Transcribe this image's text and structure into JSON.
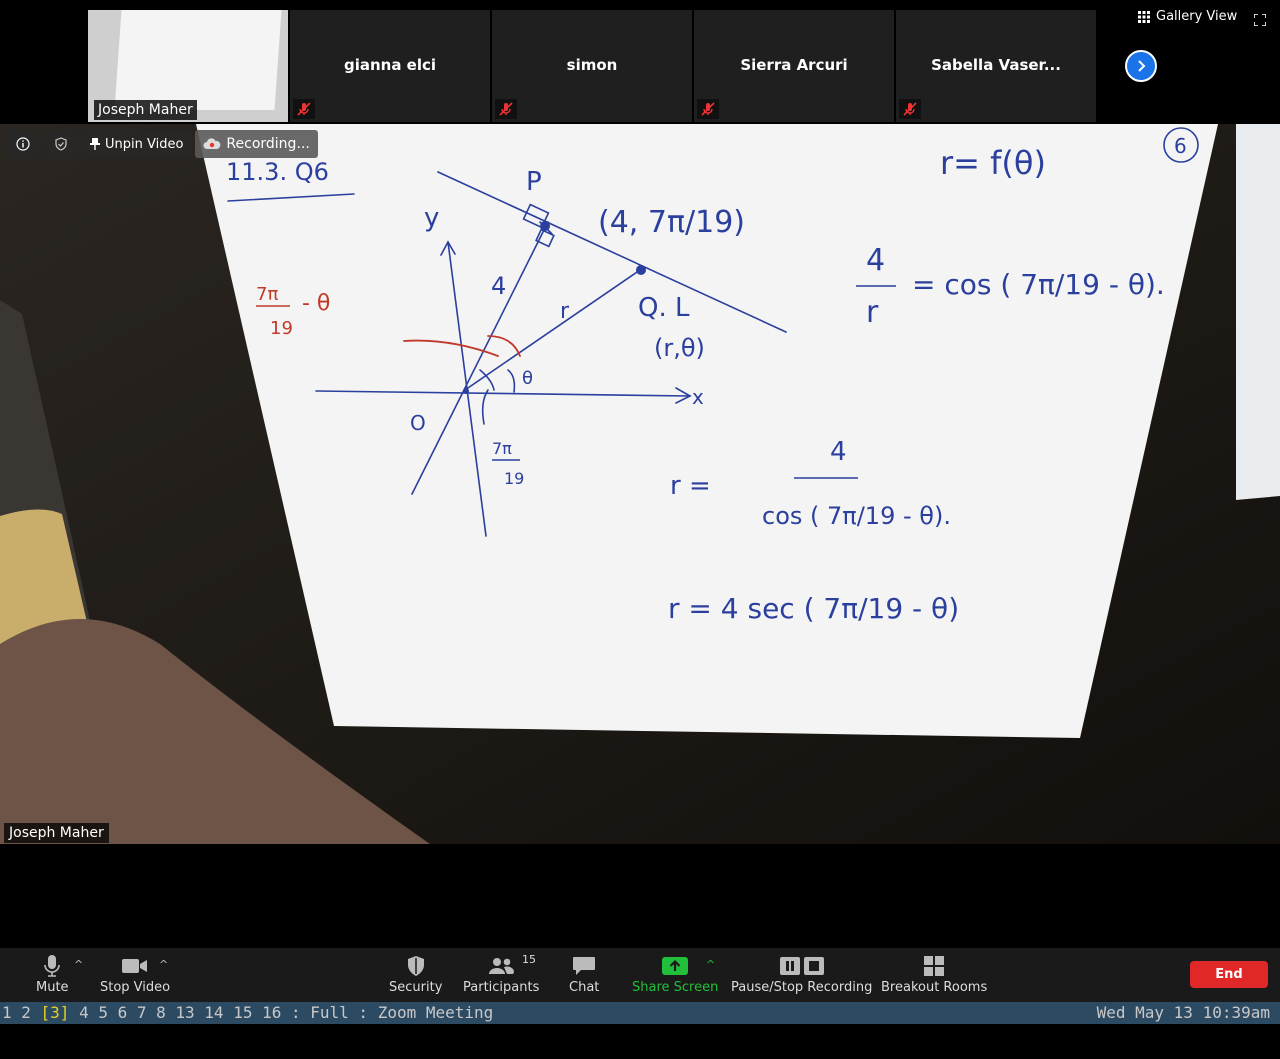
{
  "gallery": {
    "view_label": "Gallery View",
    "tiles": [
      {
        "name": "Joseph Maher",
        "muted": false
      },
      {
        "name": "gianna elci",
        "muted": true
      },
      {
        "name": "simon",
        "muted": true
      },
      {
        "name": "Sierra Arcuri",
        "muted": true
      },
      {
        "name": "Sabella Vaser...",
        "muted": true
      }
    ]
  },
  "video_toolbar": {
    "unpin_label": "Unpin Video",
    "recording_label": "Recording..."
  },
  "main_video": {
    "speaker_name": "Joseph Maher",
    "whiteboard": {
      "title": "11.3. Q6",
      "top_formula": "r= f(θ)",
      "circled_number": "6",
      "point_p": "P",
      "point_p_coords": "(4, 7π/19)",
      "point_q": "Q. L",
      "point_q_coords": "(r,θ)",
      "y_axis": "y",
      "x_axis": "x",
      "origin": "O",
      "segment_len": "4",
      "segment_r": "r",
      "theta": "θ",
      "angle_label_num": "7π",
      "angle_label_den": "19",
      "red_label_num": "7π",
      "red_label_den": "19",
      "red_label_suffix": "- θ",
      "eq1_left_num": "4",
      "eq1_left_den": "r",
      "eq1_right": "= cos ( 7π/19 - θ).",
      "eq2_left": "r =",
      "eq2_num": "4",
      "eq2_den": "cos ( 7π/19 - θ).",
      "eq3": "r = 4 sec ( 7π/19 - θ)"
    }
  },
  "bottom_bar": {
    "mute": "Mute",
    "stop_video": "Stop Video",
    "security": "Security",
    "participants": "Participants",
    "participants_count": "15",
    "chat": "Chat",
    "share_screen": "Share Screen",
    "pause_stop": "Pause/Stop Recording",
    "breakout": "Breakout Rooms",
    "end": "End"
  },
  "statusbar": {
    "workspaces_before": "1 2 ",
    "workspace_active": "[3]",
    "workspaces_after": " 4 5 6 7 8 13 14 15 16 : Full : Zoom Meeting",
    "clock": "Wed May 13 10:39am"
  },
  "colors": {
    "end_red": "#e02828",
    "share_green": "#22c03a",
    "accent_blue": "#1a73e8",
    "ink_blue": "#2b3f9e",
    "ink_red": "#c0392b"
  }
}
